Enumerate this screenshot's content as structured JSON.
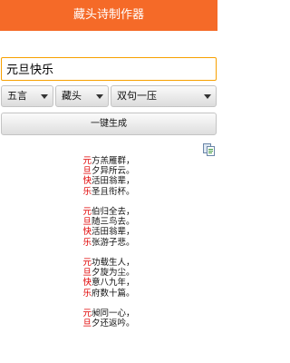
{
  "app": {
    "title": "藏头诗制作器"
  },
  "input": {
    "value": "元旦快乐",
    "placeholder": ""
  },
  "selects": {
    "char_count": "五言",
    "position": "藏头",
    "rhyme": "双句一压"
  },
  "generate_button": "一键生成",
  "icons": {
    "copy": "copy-icon"
  },
  "colors": {
    "accent": "#f56a28",
    "input_border": "#f7a000",
    "highlight": "#e00000"
  },
  "poem": {
    "stanzas": [
      [
        {
          "head": "元",
          "rest": "方羔雁群，"
        },
        {
          "head": "旦",
          "rest": "夕异所云。"
        },
        {
          "head": "快",
          "rest": "活田翁辈，"
        },
        {
          "head": "乐",
          "rest": "圣且衔杯。"
        }
      ],
      [
        {
          "head": "元",
          "rest": "伯归全去，"
        },
        {
          "head": "旦",
          "rest": "随三鸟去。"
        },
        {
          "head": "快",
          "rest": "活田翁辈，"
        },
        {
          "head": "乐",
          "rest": "张游子悲。"
        }
      ],
      [
        {
          "head": "元",
          "rest": "功载生人，"
        },
        {
          "head": "旦",
          "rest": "夕旋为尘。"
        },
        {
          "head": "快",
          "rest": "意八九年，"
        },
        {
          "head": "乐",
          "rest": "府数十篇。"
        }
      ],
      [
        {
          "head": "元",
          "rest": "昶同一心，"
        },
        {
          "head": "旦",
          "rest": "夕还返吟。"
        }
      ]
    ]
  }
}
